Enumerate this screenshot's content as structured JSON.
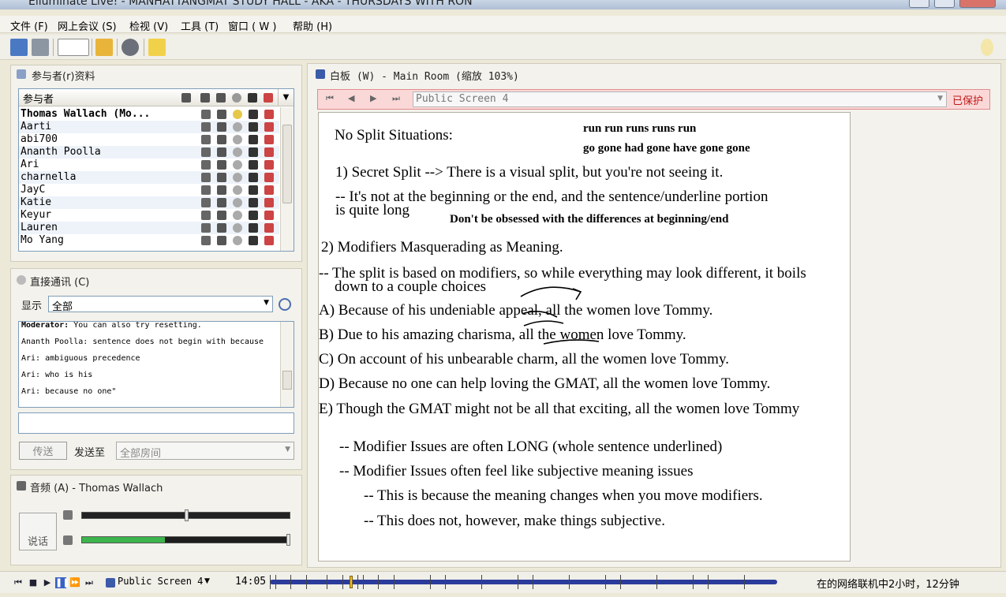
{
  "window": {
    "title": "Elluminate Live! - MANHATTANGMAT STUDY HALL - AKA - THURSDAYS WITH RON"
  },
  "menu": [
    {
      "label": "文件 (F)"
    },
    {
      "label": "网上会议 (S)"
    },
    {
      "label": "检视 (V)"
    },
    {
      "label": "工具 (T)"
    },
    {
      "label": "窗口 ( W )"
    },
    {
      "label": "帮助 (H)"
    }
  ],
  "participants": {
    "header": "参与者(r)资料",
    "column_label": "参与者",
    "rows": [
      "Thomas Wallach (Mo...",
      "Aarti",
      "abi700",
      "Ananth Poolla",
      "Ari",
      "charnella",
      "JayC",
      "Katie",
      "Keyur",
      "Lauren",
      "Mo Yang"
    ]
  },
  "chat": {
    "header": "直接通讯 (C)",
    "show_label": "显示",
    "filter_value": "全部",
    "messages": [
      {
        "who": "Moderator:",
        "text": " You can also try resetting."
      },
      {
        "who": "Ananth Poolla:",
        "text": " sentence does not begin with because"
      },
      {
        "who": "Ari:",
        "text": " ambiguous precedence"
      },
      {
        "who": "Ari:",
        "text": " who is his"
      },
      {
        "who": "Ari:",
        "text": " because no one\""
      }
    ],
    "input_value": "",
    "send_label": "传送",
    "send_to_label": "发送至",
    "send_to_value": "全部房间"
  },
  "audio": {
    "header": "音频 (A) - Thomas Wallach",
    "talk_label": "说话",
    "mic_level": 0.5,
    "speaker_level": 0.4
  },
  "whiteboard": {
    "header": "白板 (W) - Main Room (缩放 103%)",
    "screen_value": "Public Screen 4",
    "protected_label": "已保护",
    "lines": [
      "No Split Situations:",
      "run run runs runs run",
      "go gone had gone have gone gone",
      "1) Secret Split --> There is a visual split, but you're not seeing it.",
      "-- It's not at the beginning or the end, and the sentence/underline portion",
      "is quite long",
      "Don't be obsessed with the differences at beginning/end",
      "2) Modifiers Masquerading as Meaning.",
      "-- The split is based on modifiers, so while everything may look different, it boils",
      "down to a couple choices",
      "A) Because of his undeniable appeal, all the women love Tommy.",
      "B) Due to his amazing charisma, all the women love Tommy.",
      "C) On account of his unbearable charm, all the women love Tommy.",
      "D) Because no one can help loving the GMAT, all the women love Tommy.",
      "E)  Though the GMAT might not be all that exciting, all the women love Tommy",
      "-- Modifier Issues are often LONG (whole sentence underlined)",
      "-- Modifier Issues often feel like subjective meaning issues",
      "-- This is because the meaning changes when you move modifiers.",
      "-- This does not, however, make things subjective."
    ]
  },
  "status": {
    "screen_label": "Public Screen 4",
    "time": "14:05",
    "progress": 0.16,
    "online": "在的网络联机中2小时，12分钟"
  },
  "colors": {
    "protected_bg": "#fbd8d8",
    "progress": "#2b3b9c",
    "audio_level": "#3cb44b"
  }
}
